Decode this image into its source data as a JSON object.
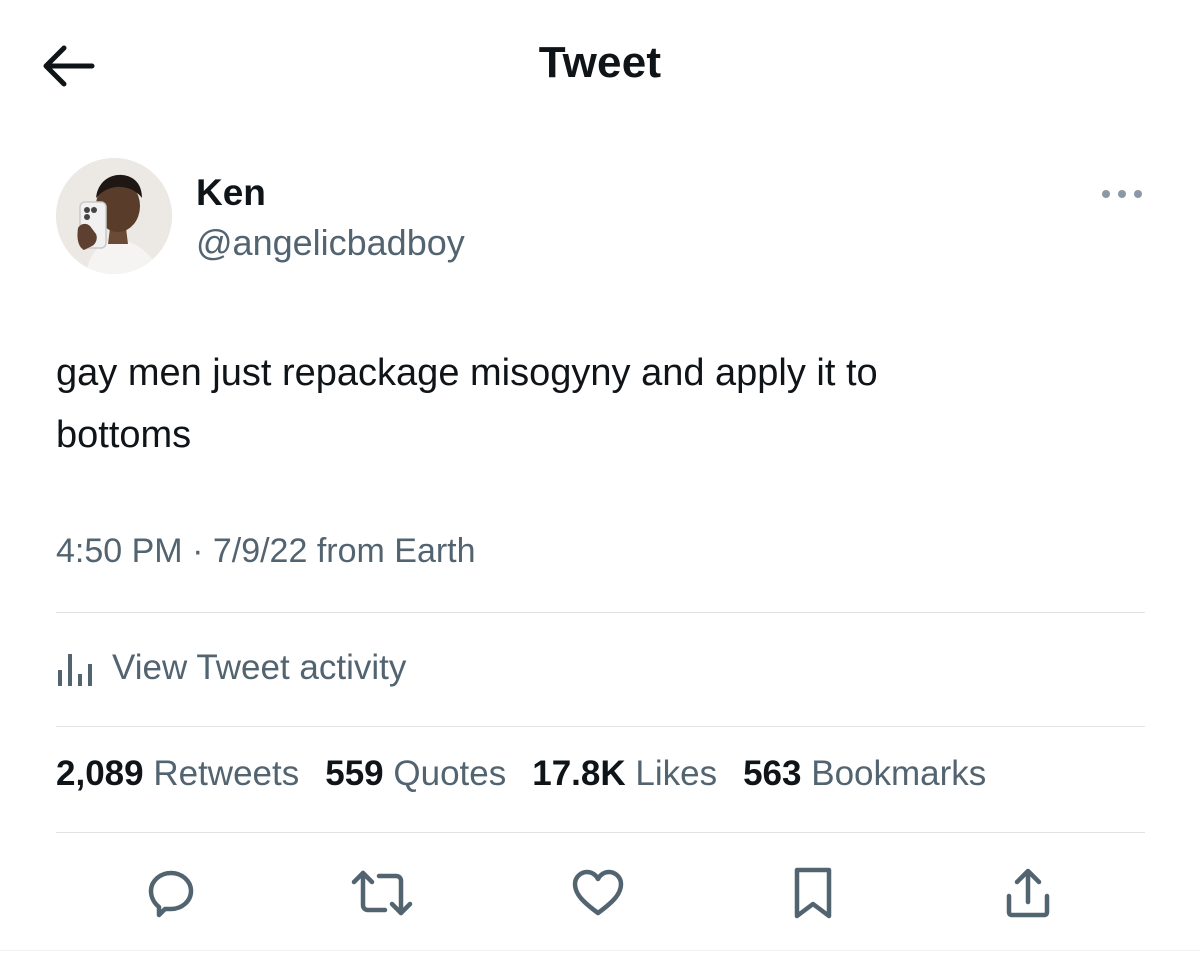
{
  "header": {
    "title": "Tweet",
    "back_icon": "arrow-left-icon"
  },
  "author": {
    "display_name": "Ken",
    "handle": "@angelicbadboy",
    "more_icon": "more-horizontal-icon"
  },
  "tweet": {
    "text_line1": "gay men just repackage misogyny and apply it to",
    "text_line2": "bottoms",
    "time": "4:50 PM",
    "separator": " · ",
    "date": "7/9/22",
    "source": " from Earth"
  },
  "activity": {
    "label": "View Tweet activity",
    "icon": "bar-chart-icon"
  },
  "stats": {
    "retweets_count": "2,089",
    "retweets_label": "Retweets",
    "quotes_count": "559",
    "quotes_label": "Quotes",
    "likes_count": "17.8K",
    "likes_label": "Likes",
    "bookmarks_count": "563",
    "bookmarks_label": "Bookmarks"
  },
  "actions": {
    "reply_icon": "reply-icon",
    "retweet_icon": "retweet-icon",
    "like_icon": "heart-icon",
    "bookmark_icon": "bookmark-icon",
    "share_icon": "share-icon"
  },
  "colors": {
    "text_primary": "#0f1419",
    "text_secondary": "#536471",
    "divider": "#dfe3e6",
    "background": "#ffffff"
  }
}
